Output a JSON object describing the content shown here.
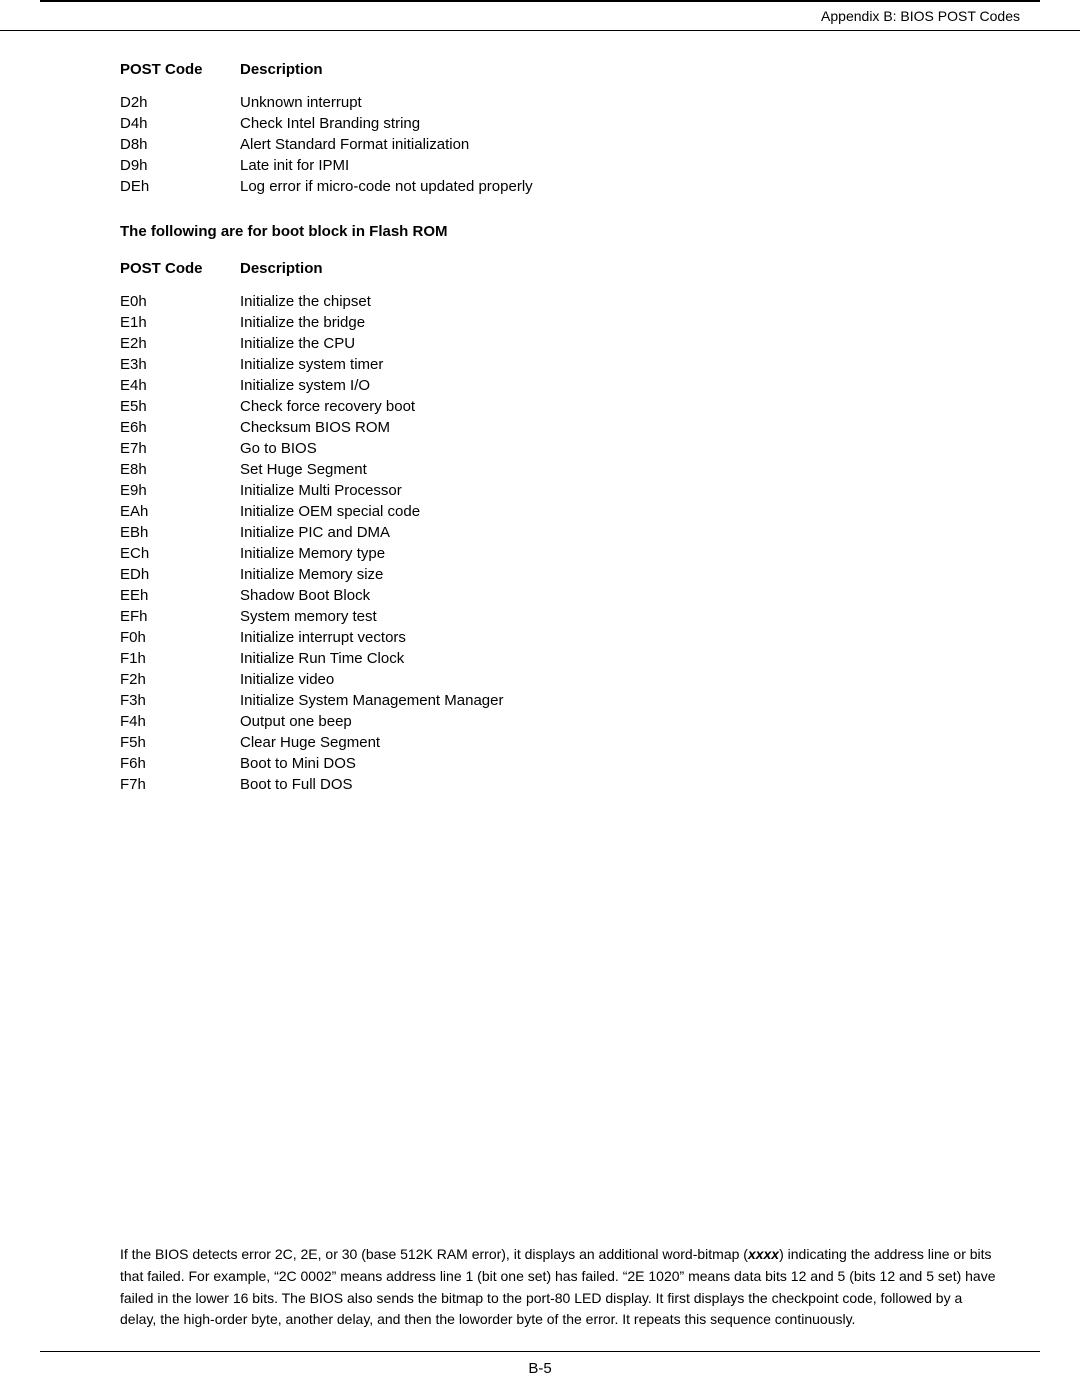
{
  "header": {
    "title": "Appendix B: BIOS POST Codes"
  },
  "section1": {
    "col_code_label": "POST Code",
    "col_desc_label": "Description",
    "rows": [
      {
        "code": "D2h",
        "desc": "Unknown interrupt"
      },
      {
        "code": "D4h",
        "desc": "Check Intel Branding string"
      },
      {
        "code": "D8h",
        "desc": "Alert Standard Format  initialization"
      },
      {
        "code": "D9h",
        "desc": "Late init for IPMI"
      },
      {
        "code": "DEh",
        "desc": "Log error if micro-code not updated properly"
      }
    ]
  },
  "section2": {
    "title": "The following are for boot block in Flash ROM",
    "col_code_label": "POST Code",
    "col_desc_label": "Description",
    "rows": [
      {
        "code": "E0h",
        "desc": "Initialize the chipset"
      },
      {
        "code": "E1h",
        "desc": "Initialize the bridge"
      },
      {
        "code": "E2h",
        "desc": "Initialize the CPU"
      },
      {
        "code": "E3h",
        "desc": "Initialize system timer"
      },
      {
        "code": "E4h",
        "desc": "Initialize system I/O"
      },
      {
        "code": "E5h",
        "desc": "Check force recovery boot"
      },
      {
        "code": "E6h",
        "desc": "Checksum BIOS ROM"
      },
      {
        "code": "E7h",
        "desc": "Go to BIOS"
      },
      {
        "code": "E8h",
        "desc": "Set Huge Segment"
      },
      {
        "code": "E9h",
        "desc": "Initialize Multi Processor"
      },
      {
        "code": "EAh",
        "desc": "Initialize OEM special code"
      },
      {
        "code": "EBh",
        "desc": "Initialize PIC and DMA"
      },
      {
        "code": "ECh",
        "desc": "Initialize Memory type"
      },
      {
        "code": "EDh",
        "desc": "Initialize Memory size"
      },
      {
        "code": "EEh",
        "desc": "Shadow Boot Block"
      },
      {
        "code": "EFh",
        "desc": "System memory test"
      },
      {
        "code": "F0h",
        "desc": "Initialize interrupt vectors"
      },
      {
        "code": "F1h",
        "desc": "Initialize Run Time Clock"
      },
      {
        "code": "F2h",
        "desc": "Initialize video"
      },
      {
        "code": "F3h",
        "desc": "Initialize System Management Manager"
      },
      {
        "code": "F4h",
        "desc": "Output one beep"
      },
      {
        "code": "F5h",
        "desc": "Clear Huge Segment"
      },
      {
        "code": "F6h",
        "desc": "Boot to Mini DOS"
      },
      {
        "code": "F7h",
        "desc": "Boot to Full DOS"
      }
    ]
  },
  "footer": {
    "note_text": " If the BIOS detects error 2C, 2E, or 30 (base 512K RAM error), it displays an additional word-bitmap (",
    "note_italic": "xxxx",
    "note_text2": ") indicating the address line or bits that failed.  For example, “2C 0002” means address line 1 (bit one set) has failed.  “2E 1020” means data bits 12 and 5 (bits 12 and 5 set) have failed in the lower 16 bits.  The BIOS also sends the bitmap to the port-80 LED display.  It first displays the checkpoint code, followed by a delay, the high-order byte, another delay, and then the loworder byte of the error.  It repeats this sequence continuously."
  },
  "page_number": "B-5"
}
